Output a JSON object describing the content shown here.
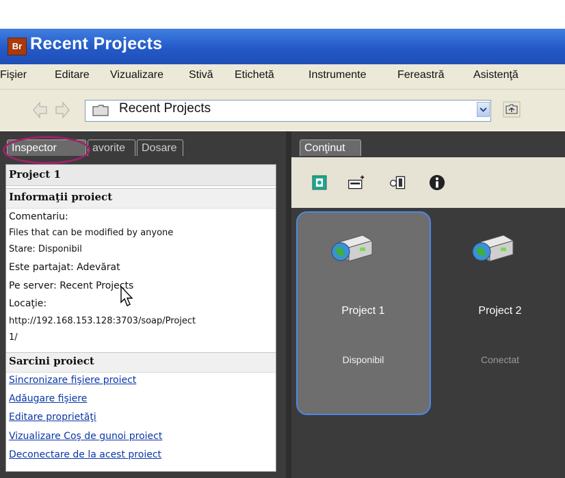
{
  "window": {
    "title": "Recent Projects",
    "app_badge": "Br"
  },
  "menu": [
    "Fişier",
    "Editare",
    "Vizualizare",
    "Stivă",
    "Etichetă",
    "Instrumente",
    "Fereastră",
    "Asistenţă"
  ],
  "toolbar": {
    "path": "Recent Projects",
    "icons": [
      "back-arrow-icon",
      "forward-arrow-icon",
      "folder-icon",
      "dropdown-arrow-icon",
      "folder-up-icon"
    ]
  },
  "left_tabs": [
    "Inspector",
    "avorite",
    "Dosare"
  ],
  "inspector": {
    "header": "Project 1",
    "info_title": "Informaţii proiect",
    "lines": [
      "Comentariu:",
      "Files that can be modified by anyone",
      "Stare: Disponibil",
      "Este partajat: Adevărat",
      "Pe server: Recent Projects",
      "Locaţie:",
      "http://192.168.153.128:3703/soap/Project",
      "1/"
    ],
    "tasks_title": "Sarcini proiect",
    "tasks": [
      "Sincronizare fişiere proiect",
      "Adăugare fişiere",
      "Editare proprietăţi",
      "Vizualizare Coş de gunoi proiect",
      "Deconectare de la acest proiect"
    ]
  },
  "content": {
    "tab": "Conţinut",
    "toolbar_icons": [
      "new-project-icon",
      "connect-server-icon",
      "cut-icon",
      "info-icon"
    ],
    "projects": [
      {
        "name": "Project 1",
        "status": "Disponibil",
        "selected": true
      },
      {
        "name": "Project 2",
        "status": "Conectat",
        "selected": false
      }
    ]
  },
  "colors": {
    "title_bar": "#2459c8",
    "selection_border": "#4f86e6",
    "highlight_ellipse": "#a0226a",
    "link": "#0a36a8"
  }
}
